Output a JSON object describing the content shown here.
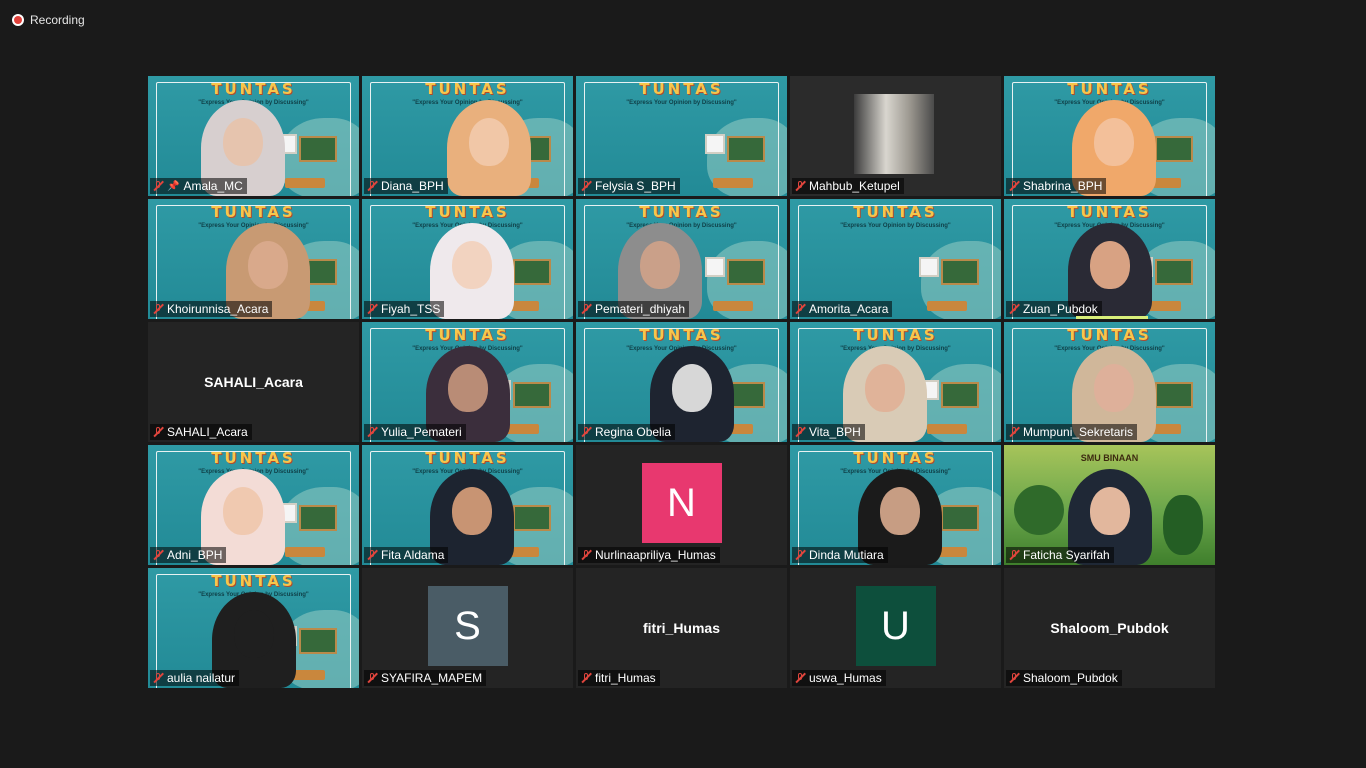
{
  "recording": {
    "label": "Recording"
  },
  "colors": {
    "active_speaker": "#d9ef7a",
    "muted": "#e0453d"
  },
  "participants": [
    {
      "name": "Amala_MC",
      "video": "slide",
      "skin": "#e6c4ae",
      "hijab": "#d7cfcf",
      "x": 45,
      "pinned": true,
      "active": true
    },
    {
      "name": "Diana_BPH",
      "video": "slide",
      "skin": "#f1c7a7",
      "hijab": "#e9b07d",
      "x": 60
    },
    {
      "name": "Felysia S_BPH",
      "video": "slide-empty"
    },
    {
      "name": "Mahbub_Ketupel",
      "video": "elevator"
    },
    {
      "name": "Shabrina_BPH",
      "video": "slide",
      "skin": "#f3c09a",
      "hijab": "#f0a86a",
      "x": 52
    },
    {
      "name": "Khoirunnisa_Acara",
      "video": "slide",
      "skin": "#d9a98b",
      "hijab": "#c89a73",
      "x": 57
    },
    {
      "name": "Fiyah_TSS",
      "video": "slide",
      "skin": "#f2d3c0",
      "hijab": "#efe9ec",
      "x": 52
    },
    {
      "name": "Pemateri_dhiyah",
      "video": "slide",
      "skin": "#caa089",
      "hijab": "#8d8d8d",
      "x": 40
    },
    {
      "name": "Amorita_Acara",
      "video": "slide-empty"
    },
    {
      "name": "Zuan_Pubdok",
      "video": "slide",
      "skin": "#d8a283",
      "hijab": "#2a2a35",
      "x": 50,
      "speaker_bar": true
    },
    {
      "name": "SAHALI_Acara",
      "video": "off",
      "display_name": "SAHALI_Acara"
    },
    {
      "name": "Yulia_Pemateri",
      "video": "slide",
      "skin": "#b98c76",
      "hijab": "#3b2e3c",
      "x": 50
    },
    {
      "name": "Regina Obelia",
      "video": "slide",
      "skin": "#d7d7d7",
      "hijab": "#1e2430",
      "x": 55
    },
    {
      "name": "Vita_BPH",
      "video": "slide",
      "skin": "#e0b399",
      "hijab": "#d9cbb6",
      "x": 45
    },
    {
      "name": "Mumpuni_Sekretaris",
      "video": "slide",
      "skin": "#deb09a",
      "hijab": "#d0b79a",
      "x": 52
    },
    {
      "name": "Adni_BPH",
      "video": "slide",
      "skin": "#f0c9b0",
      "hijab": "#f3dcd6",
      "x": 45
    },
    {
      "name": "Fita Aldama",
      "video": "slide",
      "skin": "#c89473",
      "hijab": "#1d2430",
      "x": 52
    },
    {
      "name": "Nurlinaapriliya_Humas",
      "video": "avatar",
      "initial": "N",
      "avatar_color": "#e8386f"
    },
    {
      "name": "Dinda Mutiara",
      "video": "slide",
      "skin": "#c79d83",
      "hijab": "#1b1b1b",
      "x": 52
    },
    {
      "name": "Faticha Syarifah",
      "video": "nature",
      "skin": "#e2b79d",
      "hijab": "#1f2836",
      "x": 50,
      "nature_title": "SMU BINAAN"
    },
    {
      "name": "aulia nailatur",
      "video": "slide",
      "skin": "#1f1f1f",
      "hijab": "#1f1f1f",
      "x": 50
    },
    {
      "name": "SYAFIRA_MAPEM",
      "video": "avatar",
      "initial": "S",
      "avatar_color": "#4a5c66"
    },
    {
      "name": "fitri_Humas",
      "video": "off",
      "display_name": "fitri_Humas"
    },
    {
      "name": "uswa_Humas",
      "video": "avatar",
      "initial": "U",
      "avatar_color": "#0d4f3c"
    },
    {
      "name": "Shaloom_Pubdok",
      "video": "off",
      "display_name": "Shaloom_Pubdok"
    }
  ],
  "slide": {
    "title": "TUNTAS",
    "subtitle": "\"Express Your Opinion by Discussing\""
  }
}
